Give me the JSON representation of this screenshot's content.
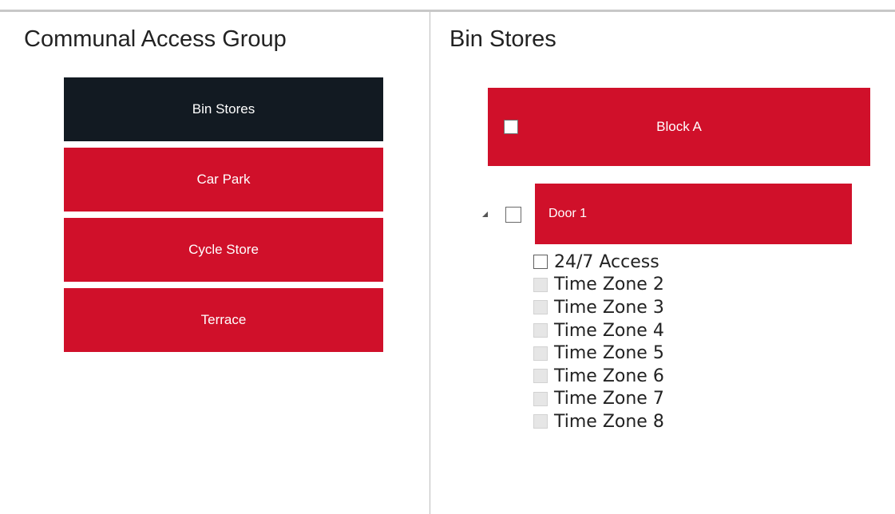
{
  "left_panel": {
    "title": "Communal Access Group",
    "groups": [
      {
        "label": "Bin Stores",
        "active": true
      },
      {
        "label": "Car Park",
        "active": false
      },
      {
        "label": "Cycle Store",
        "active": false
      },
      {
        "label": "Terrace",
        "active": false
      }
    ]
  },
  "right_panel": {
    "title": "Bin Stores",
    "block": {
      "label": "Block A",
      "checked": false
    },
    "door": {
      "label": "Door 1",
      "checked": false,
      "expanded": true
    },
    "time_zones": [
      {
        "label": "24/7 Access",
        "enabled": true,
        "checked": false
      },
      {
        "label": "Time Zone 2",
        "enabled": false,
        "checked": false
      },
      {
        "label": "Time Zone 3",
        "enabled": false,
        "checked": false
      },
      {
        "label": "Time Zone 4",
        "enabled": false,
        "checked": false
      },
      {
        "label": "Time Zone 5",
        "enabled": false,
        "checked": false
      },
      {
        "label": "Time Zone 6",
        "enabled": false,
        "checked": false
      },
      {
        "label": "Time Zone 7",
        "enabled": false,
        "checked": false
      },
      {
        "label": "Time Zone 8",
        "enabled": false,
        "checked": false
      }
    ]
  },
  "colors": {
    "accent_red": "#d0102a",
    "active_dark": "#121a22",
    "text": "#222222"
  }
}
